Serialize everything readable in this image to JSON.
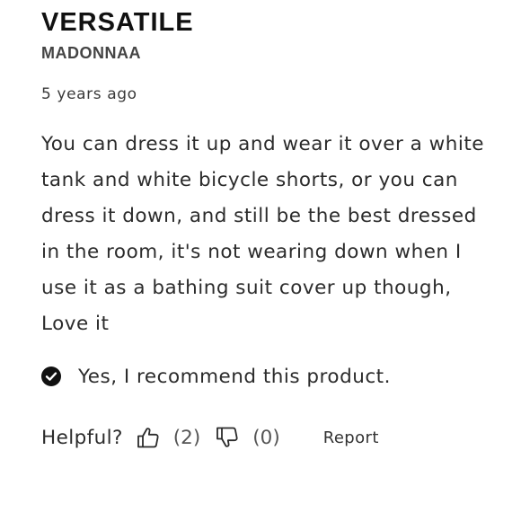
{
  "review": {
    "title": "VERSATILE",
    "author": "MADONNAA",
    "date": "5 years ago",
    "body": "You can dress it up and wear it over a white tank and white bicycle shorts, or you can dress it down, and still be the best dressed in the room, it's not wearing down when I use it as a bathing suit cover up though, Love it",
    "recommend_text": "Yes, I recommend this product.",
    "recommend_icon": "check-circle-icon"
  },
  "feedback": {
    "helpful_label": "Helpful?",
    "upvote_icon": "thumbs-up-icon",
    "upvote_count": "(2)",
    "downvote_icon": "thumbs-down-icon",
    "downvote_count": "(0)",
    "report_label": "Report"
  },
  "colors": {
    "text": "#2b2b2b",
    "title": "#111111",
    "author": "#444444",
    "background": "#ffffff"
  }
}
